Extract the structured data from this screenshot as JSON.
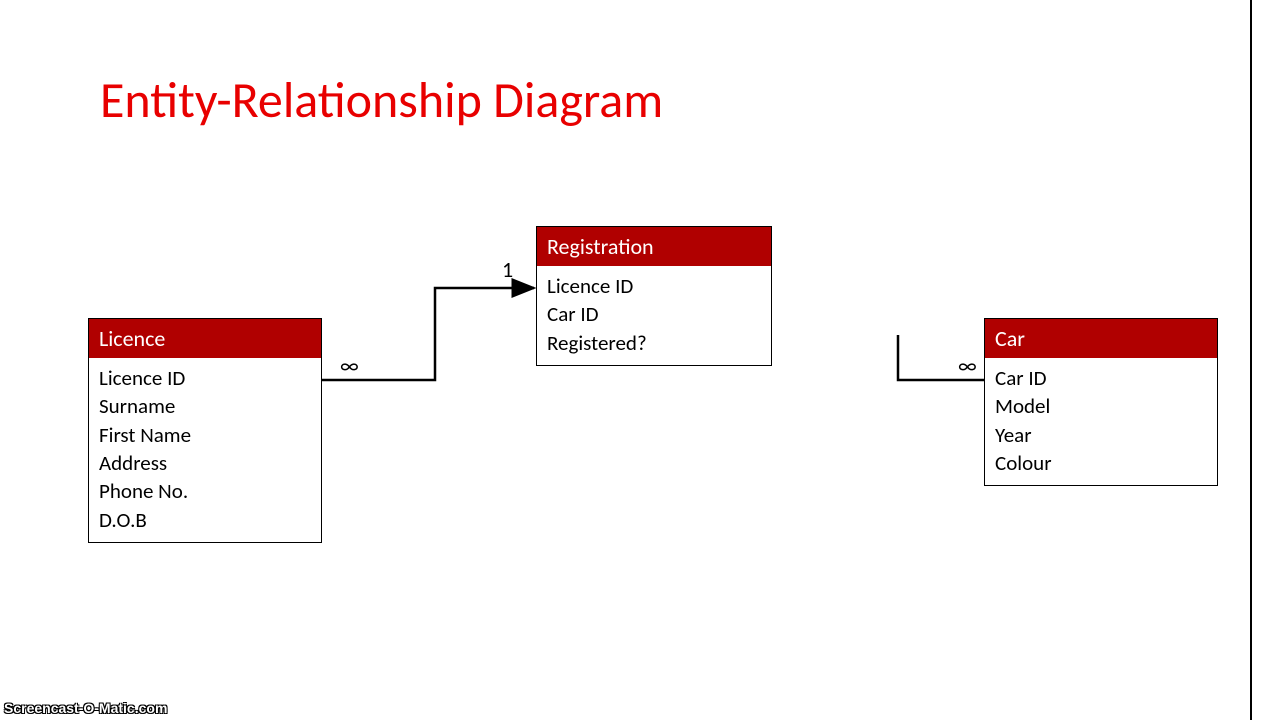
{
  "title": "Entity-Relationship Diagram",
  "entities": {
    "licence": {
      "name": "Licence",
      "fields": [
        "Licence ID",
        "Surname",
        "First Name",
        "Address",
        "Phone No.",
        "D.O.B"
      ]
    },
    "registration": {
      "name": "Registration",
      "fields": [
        "Licence ID",
        "Car ID",
        "Registered?"
      ]
    },
    "car": {
      "name": "Car",
      "fields": [
        "Car ID",
        "Model",
        "Year",
        "Colour"
      ]
    }
  },
  "cardinality": {
    "licence_side": "∞",
    "registration_side": "1",
    "car_side": "∞"
  },
  "watermark": "Screencast-O-Matic.com"
}
